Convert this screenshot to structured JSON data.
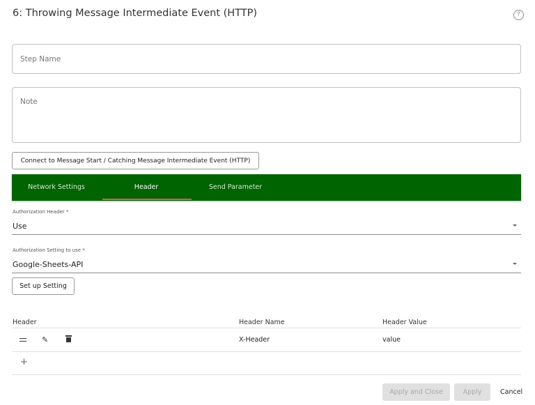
{
  "header": {
    "title": "6: Throwing Message Intermediate Event (HTTP)",
    "help_icon": "?"
  },
  "form": {
    "step_name_placeholder": "Step Name",
    "note_placeholder": "Note",
    "connect_button": "Connect to Message Start / Catching Message Intermediate Event (HTTP)"
  },
  "tabs": [
    {
      "label": "Network Settings",
      "active": false
    },
    {
      "label": "Header",
      "active": true
    },
    {
      "label": "Send Parameter",
      "active": false
    }
  ],
  "tab_bar_color": "#006400",
  "tab_indicator_color": "#e05a6b",
  "auth_header": {
    "label": "Authorization Header *",
    "value": "Use"
  },
  "auth_setting": {
    "label": "Authorization Setting to use *",
    "value": "Google-Sheets-API"
  },
  "setup_button": "Set up Setting",
  "table": {
    "columns": [
      "Header",
      "Header Name",
      "Header Value"
    ],
    "rows": [
      {
        "name": "X-Header",
        "value": "value"
      }
    ],
    "add_icon": "+"
  },
  "footer": {
    "apply_close": "Apply and Close",
    "apply": "Apply",
    "cancel": "Cancel"
  }
}
